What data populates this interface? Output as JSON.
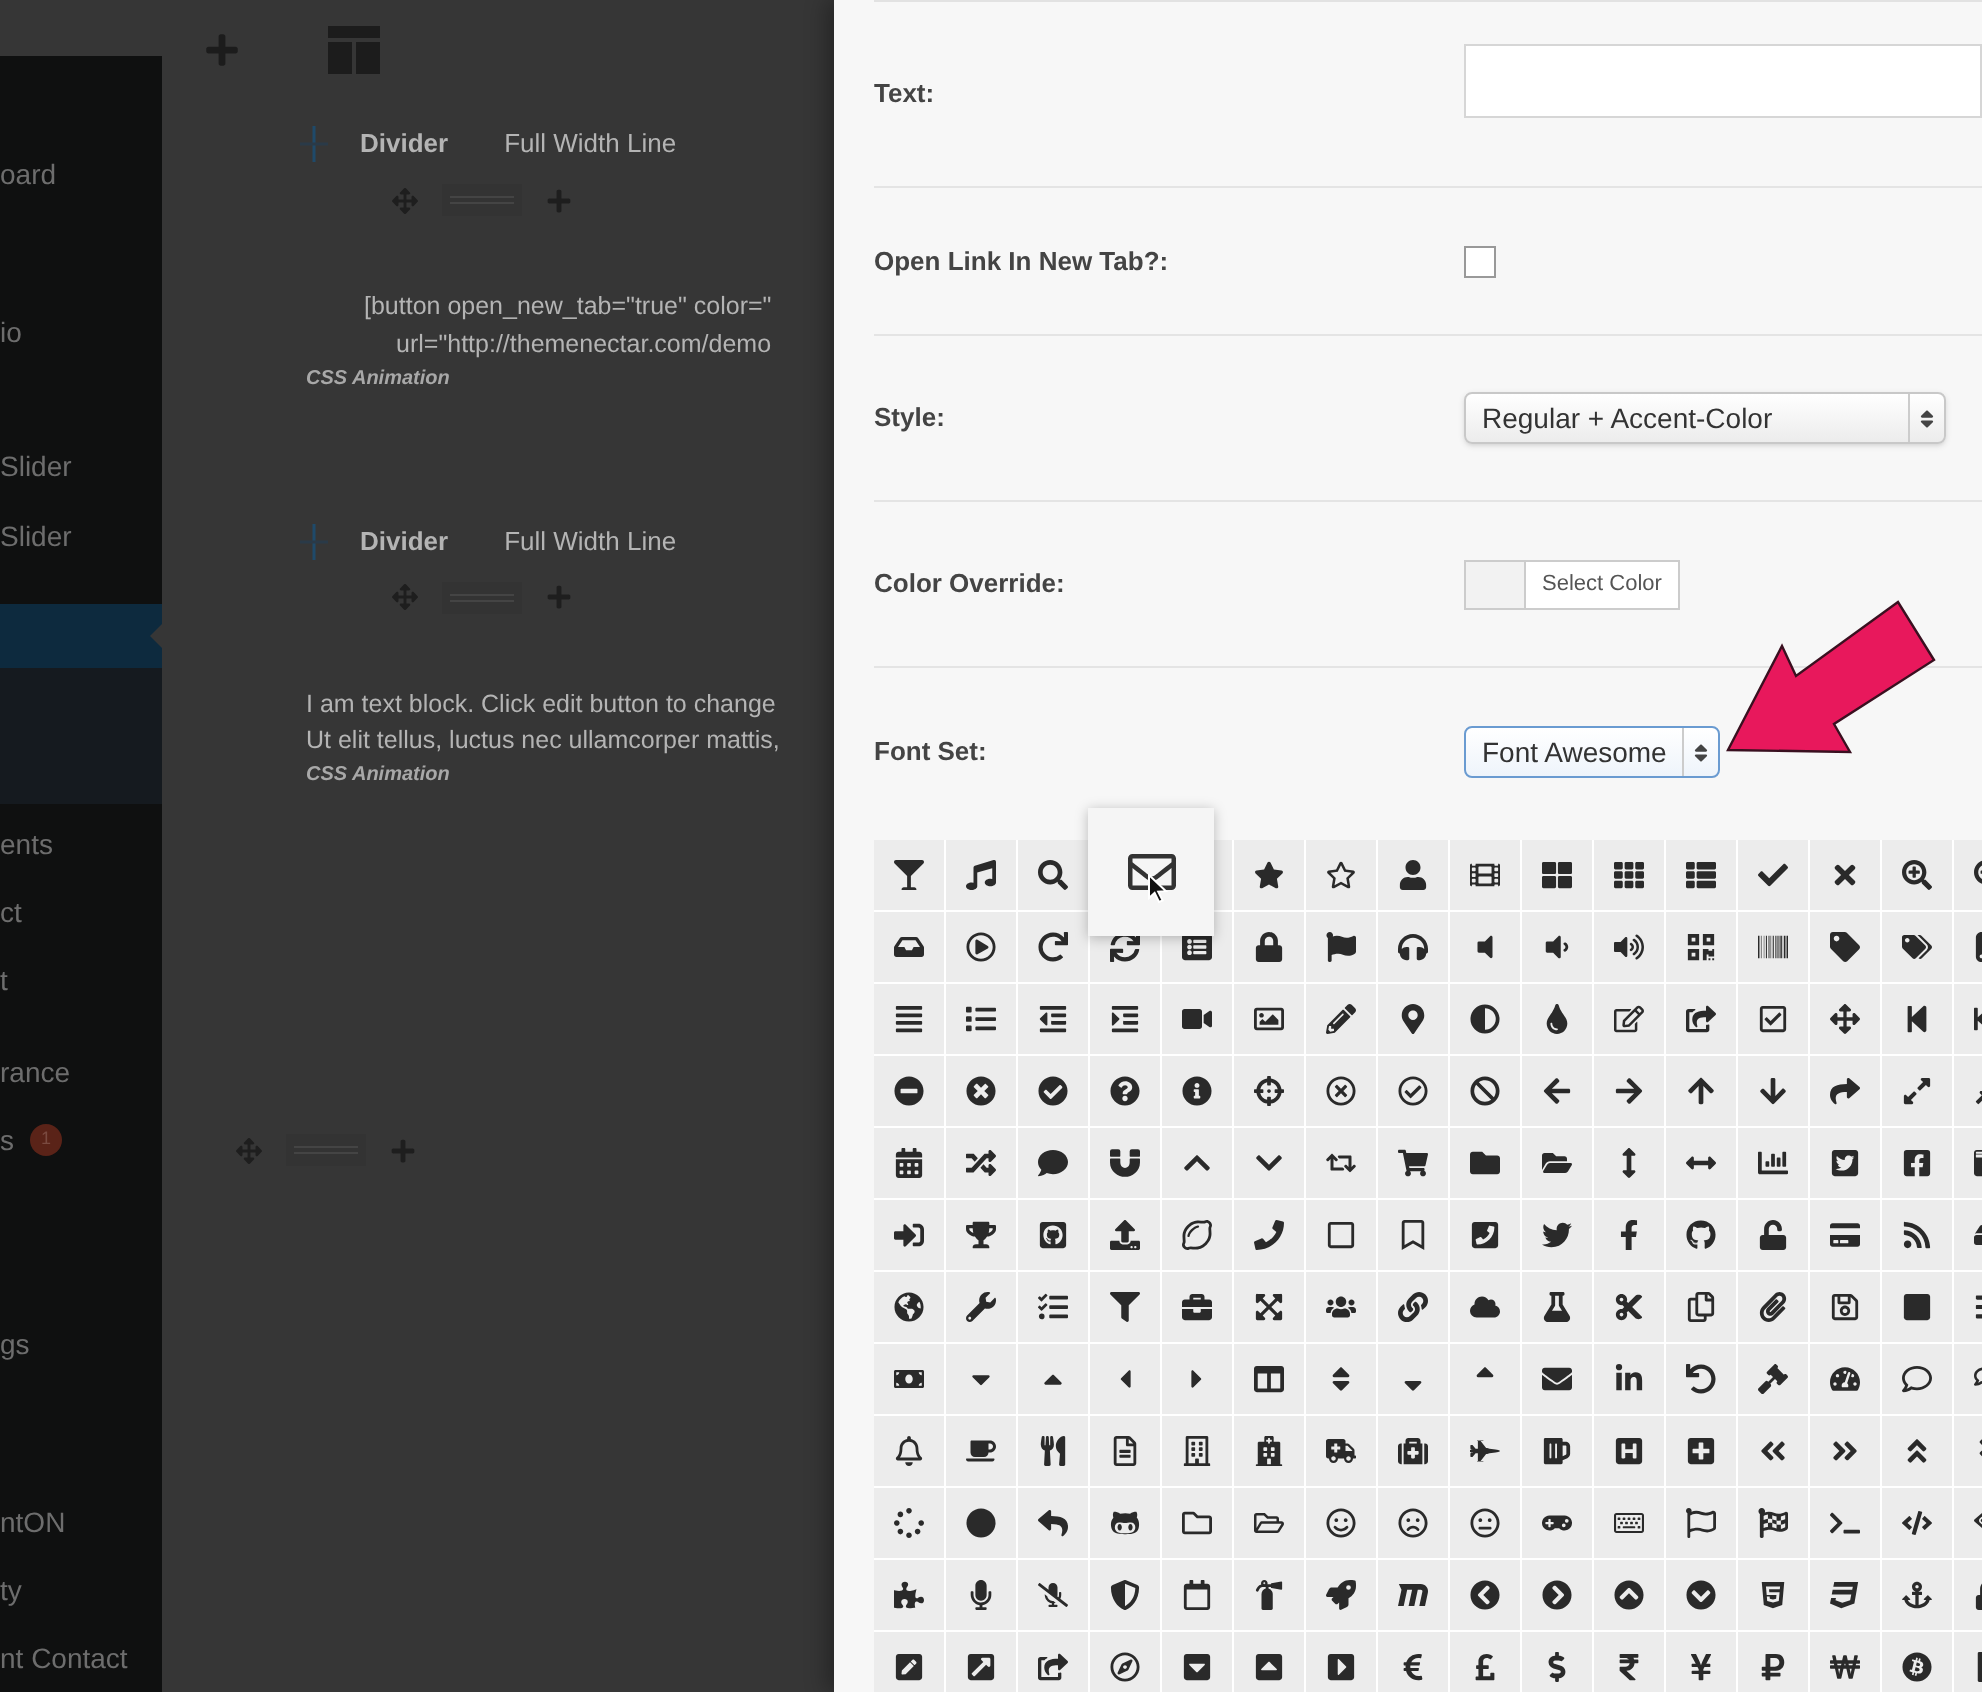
{
  "sidebar": {
    "items": [
      {
        "label": "oard",
        "selected": false
      },
      {
        "label": "io",
        "selected": false
      },
      {
        "label": "Slider",
        "selected": false
      },
      {
        "label": "Slider",
        "selected": false
      },
      {
        "selected": true
      },
      {
        "label": "ents",
        "selected": false
      },
      {
        "label": "ct",
        "selected": false
      },
      {
        "label": "t",
        "selected": false
      },
      {
        "label": "rance",
        "selected": false
      },
      {
        "label": "s",
        "selected": false,
        "badge": "1"
      },
      {
        "label": "gs",
        "selected": false
      },
      {
        "label": "ntON",
        "selected": false
      },
      {
        "label": "ty",
        "selected": false
      },
      {
        "label": "nt Contact",
        "selected": false
      }
    ]
  },
  "builder": {
    "elements": [
      {
        "kind": "divider",
        "title": "Divider",
        "subtitle": "Full Width Line",
        "lines": [
          "[button open_new_tab=\"true\" color=\"",
          "url=\"http://themenectar.com/demo"
        ],
        "animation": "CSS Animation"
      },
      {
        "kind": "divider",
        "title": "Divider",
        "subtitle": "Full Width Line",
        "lines": [
          "I am text block. Click edit button to change",
          "Ut elit tellus, luctus nec ullamcorper mattis,"
        ],
        "animation": "CSS Animation"
      },
      {
        "kind": "empty"
      }
    ]
  },
  "form": {
    "fields": [
      {
        "kind": "text",
        "label": "Text:"
      },
      {
        "kind": "checkbox",
        "label": "Open Link In New Tab?:",
        "checked": false
      },
      {
        "kind": "select",
        "label": "Style:",
        "value": "Regular + Accent-Color",
        "focused": false
      },
      {
        "kind": "color",
        "label": "Color Override:",
        "button": "Select Color"
      },
      {
        "kind": "select",
        "label": "Font Set:",
        "value": "Font Awesome",
        "focused": true
      }
    ]
  }
}
